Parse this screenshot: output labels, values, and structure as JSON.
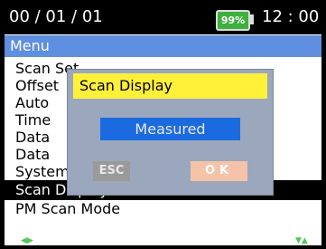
{
  "status": {
    "date": "00 / 01 / 01",
    "battery": "99%",
    "time": "12 : 00"
  },
  "menu": {
    "title": "Menu",
    "items": [
      {
        "label": "Scan Set"
      },
      {
        "label": "Offset"
      },
      {
        "label": "Auto"
      },
      {
        "label": "Time"
      },
      {
        "label": "Data"
      },
      {
        "label": "Data"
      },
      {
        "label": "System Info"
      },
      {
        "label": "Scan Display"
      },
      {
        "label": "PM Scan Mode"
      }
    ],
    "selected_index": 7
  },
  "nav_hints": {
    "left": "◀▶",
    "right": "▼▲"
  },
  "dialog": {
    "title": "Scan Display",
    "value": "Measured",
    "esc_label": "ESC",
    "ok_label": "OK"
  },
  "colors": {
    "header": "#5f8fe0",
    "dialog_title": "#fff03a",
    "dialog_value": "#1b6be0",
    "battery": "#3fb03f"
  }
}
